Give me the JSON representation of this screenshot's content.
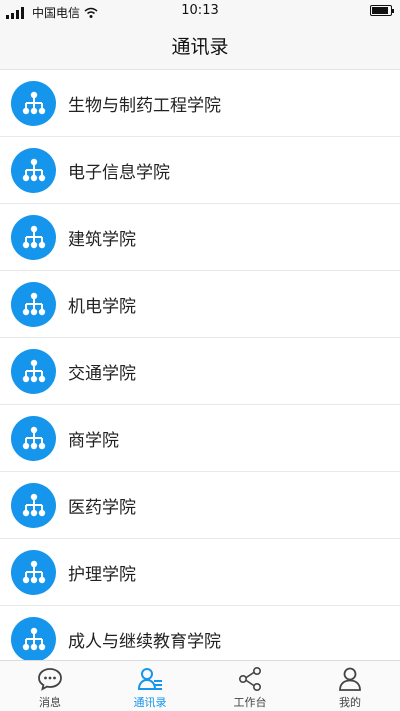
{
  "status_bar": {
    "carrier": "中国电信",
    "time": "10:13"
  },
  "header": {
    "title": "通讯录"
  },
  "departments": [
    {
      "label": "生物与制药工程学院",
      "icon": "org-chart-icon"
    },
    {
      "label": "电子信息学院",
      "icon": "org-chart-icon"
    },
    {
      "label": "建筑学院",
      "icon": "org-chart-icon"
    },
    {
      "label": "机电学院",
      "icon": "org-chart-icon"
    },
    {
      "label": "交通学院",
      "icon": "org-chart-icon"
    },
    {
      "label": "商学院",
      "icon": "org-chart-icon"
    },
    {
      "label": "医药学院",
      "icon": "org-chart-icon"
    },
    {
      "label": "护理学院",
      "icon": "org-chart-icon"
    },
    {
      "label": "成人与继续教育学院",
      "icon": "org-chart-icon"
    }
  ],
  "tab_bar": {
    "tabs": [
      {
        "label": "消息",
        "icon": "chat-bubble-icon",
        "active": false
      },
      {
        "label": "通讯录",
        "icon": "contacts-icon",
        "active": true
      },
      {
        "label": "工作台",
        "icon": "share-nodes-icon",
        "active": false
      },
      {
        "label": "我的",
        "icon": "person-icon",
        "active": false
      }
    ]
  },
  "colors": {
    "accent": "#1595ec",
    "header_bg": "#f7f7f7",
    "divider": "#e8e8e8"
  }
}
